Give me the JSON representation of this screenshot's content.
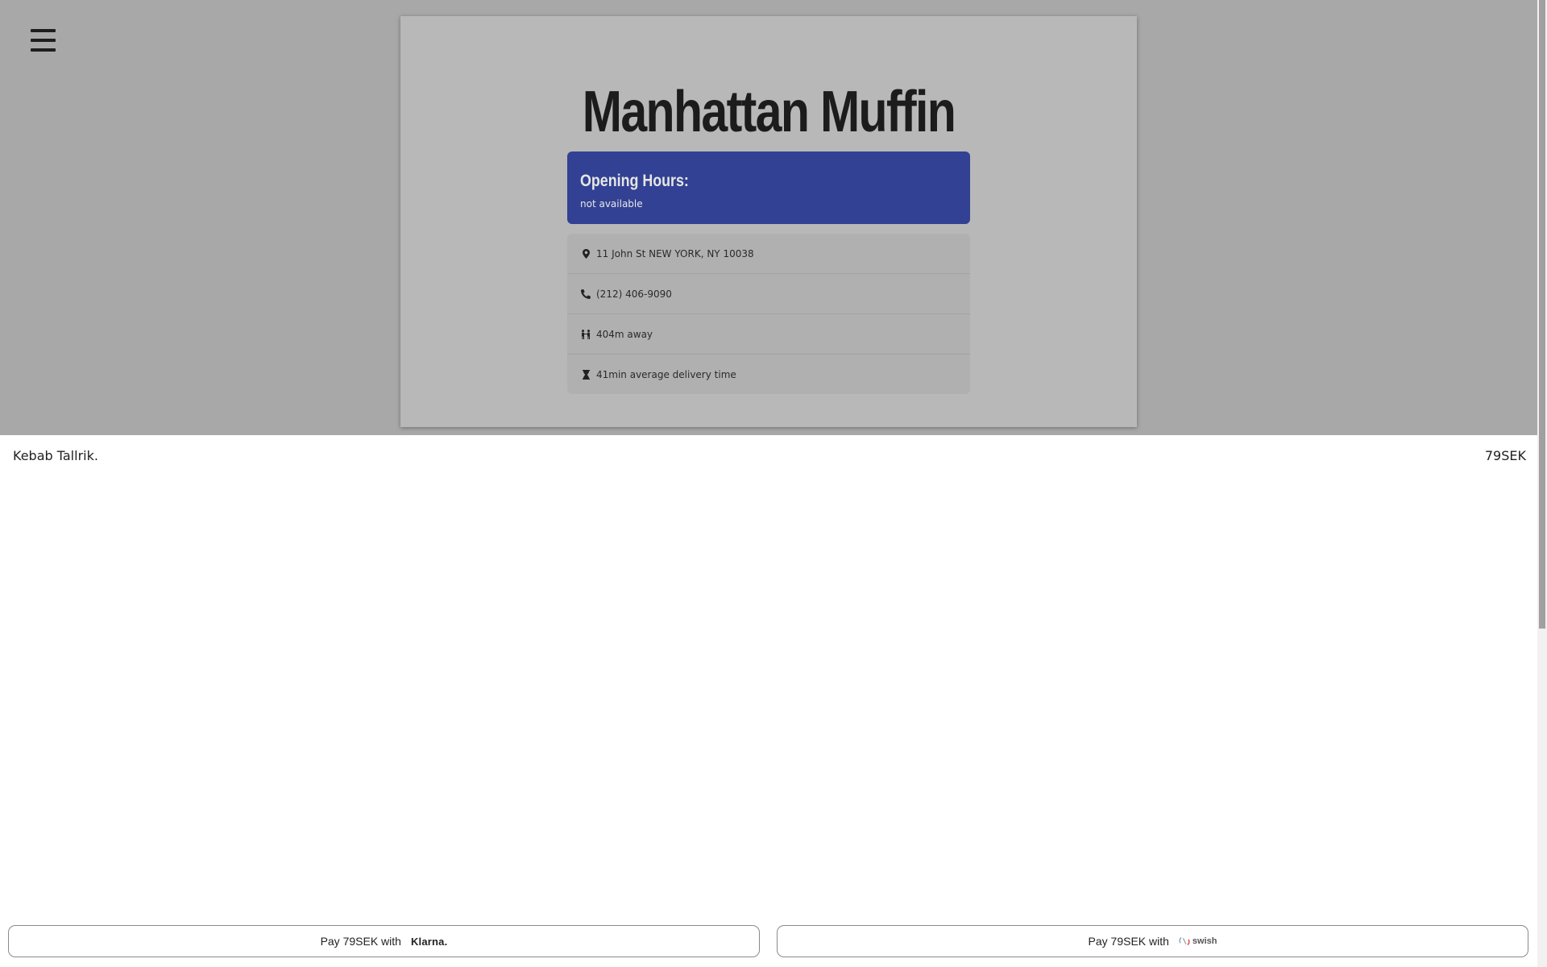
{
  "header": {
    "menu_icon": "hamburger-menu-icon"
  },
  "restaurant": {
    "name": "Manhattan Muffin",
    "hours_title": "Opening Hours:",
    "hours_status": "not available",
    "info": [
      {
        "icon": "map-marker-icon",
        "text": "11 John St NEW YORK, NY 10038"
      },
      {
        "icon": "phone-icon",
        "text": "(212) 406-9090"
      },
      {
        "icon": "walking-people-icon",
        "text": "404m away"
      },
      {
        "icon": "hourglass-icon",
        "text": "41min average delivery time"
      }
    ]
  },
  "order": {
    "item_name": "Kebab Tallrik.",
    "item_price": "79SEK"
  },
  "payment": {
    "klarna_label": "Pay 79SEK with",
    "klarna_brand": "Klarna.",
    "swish_label": "Pay 79SEK with",
    "swish_brand": "swish"
  },
  "colors": {
    "hero_bg": "#a8a8a8",
    "card_bg": "#b8b8b8",
    "hours_bg": "#324193"
  }
}
